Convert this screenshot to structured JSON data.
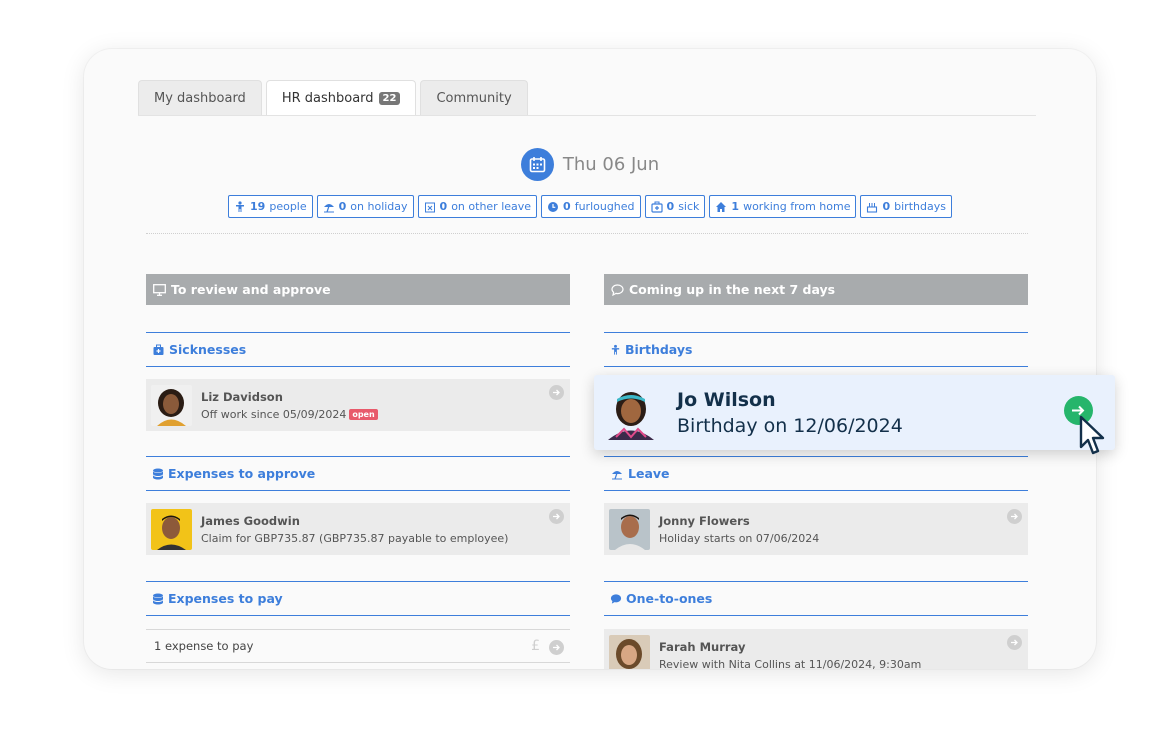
{
  "tabs": [
    {
      "label": "My dashboard"
    },
    {
      "label": "HR dashboard",
      "badge": "22"
    },
    {
      "label": "Community"
    }
  ],
  "date": "Thu 06 Jun",
  "stats": [
    {
      "icon": "person-icon",
      "num": "19",
      "label": "people"
    },
    {
      "icon": "umbrella-icon",
      "num": "0",
      "label": "on holiday"
    },
    {
      "icon": "calendar-x-icon",
      "num": "0",
      "label": "on other leave"
    },
    {
      "icon": "clock-icon",
      "num": "0",
      "label": "furloughed"
    },
    {
      "icon": "medical-bag-icon",
      "num": "0",
      "label": "sick"
    },
    {
      "icon": "home-icon",
      "num": "1",
      "label": "working from home"
    },
    {
      "icon": "cake-icon",
      "num": "0",
      "label": "birthdays"
    }
  ],
  "left": {
    "header": "To review and approve",
    "sicknesses": {
      "title": "Sicknesses",
      "name": "Liz Davidson",
      "sub": "Off work since 05/09/2024",
      "badge": "open"
    },
    "expenses_approve": {
      "title": "Expenses to approve",
      "name": "James Goodwin",
      "sub": "Claim for GBP735.87 (GBP735.87 payable to employee)"
    },
    "expenses_pay": {
      "title": "Expenses to pay",
      "text": "1 expense to pay",
      "currency": "£"
    }
  },
  "right": {
    "header": "Coming up in the next 7 days",
    "birthdays": {
      "title": "Birthdays"
    },
    "leave": {
      "title": "Leave",
      "name": "Jonny Flowers",
      "sub": "Holiday starts on 07/06/2024"
    },
    "one_to_ones": {
      "title": "One-to-ones",
      "name": "Farah Murray",
      "sub": "Review with Nita Collins at 11/06/2024, 9:30am"
    }
  },
  "popup": {
    "name": "Jo Wilson",
    "sub": "Birthday on 12/06/2024"
  },
  "colors": {
    "accent": "#3d7edb",
    "header_gray": "#a8abad",
    "go_green": "#26b56b",
    "badge_red": "#e85a6b"
  }
}
